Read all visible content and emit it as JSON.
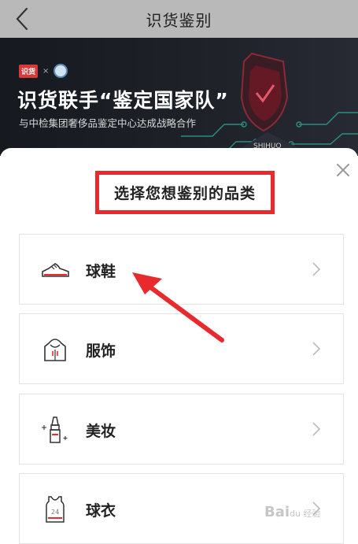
{
  "header": {
    "title": "识货鉴别"
  },
  "banner": {
    "brand_logo": "识货",
    "brand_x": "×",
    "headline": "识货联手“鉴定国家队”",
    "subtitle": "与中检集团奢侈品鉴定中心达成战略合作",
    "art_label": "SHIHUO"
  },
  "sheet": {
    "title": "选择您想鉴别的品类",
    "categories": [
      {
        "label": "球鞋",
        "icon": "sneaker-icon"
      },
      {
        "label": "服饰",
        "icon": "hoodie-icon"
      },
      {
        "label": "美妆",
        "icon": "lipstick-icon"
      },
      {
        "label": "球衣",
        "icon": "jersey-icon"
      }
    ]
  },
  "watermark": {
    "text": "Bai",
    "sub": "du 经验"
  },
  "colors": {
    "accent_red": "#e8292e",
    "header_bg": "#b9b9b9",
    "banner_bg": "#1d2027"
  }
}
